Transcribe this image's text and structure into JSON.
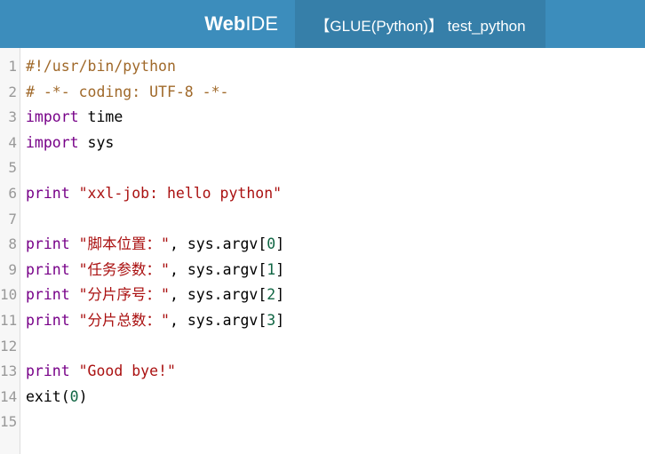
{
  "header": {
    "brand_bold": "Web",
    "brand_thin": "IDE",
    "tab_label": "【GLUE(Python)】 test_python"
  },
  "colors": {
    "header_bg": "#3c8dbc",
    "tab_bg": "#367fa9",
    "comment": "#a0692a",
    "keyword": "#770088",
    "string": "#aa1111",
    "number": "#116644"
  },
  "editor": {
    "lines": [
      {
        "n": "1",
        "tokens": [
          {
            "t": "comment",
            "v": "#!/usr/bin/python"
          }
        ]
      },
      {
        "n": "2",
        "tokens": [
          {
            "t": "comment",
            "v": "# -*- coding: UTF-8 -*-"
          }
        ]
      },
      {
        "n": "3",
        "tokens": [
          {
            "t": "keyword",
            "v": "import"
          },
          {
            "t": "plain",
            "v": " time"
          }
        ]
      },
      {
        "n": "4",
        "tokens": [
          {
            "t": "keyword",
            "v": "import"
          },
          {
            "t": "plain",
            "v": " sys"
          }
        ]
      },
      {
        "n": "5",
        "tokens": []
      },
      {
        "n": "6",
        "tokens": [
          {
            "t": "keyword",
            "v": "print"
          },
          {
            "t": "plain",
            "v": " "
          },
          {
            "t": "string",
            "v": "\"xxl-job: hello python\""
          }
        ]
      },
      {
        "n": "7",
        "tokens": []
      },
      {
        "n": "8",
        "tokens": [
          {
            "t": "keyword",
            "v": "print"
          },
          {
            "t": "plain",
            "v": " "
          },
          {
            "t": "string",
            "v": "\"脚本位置：\""
          },
          {
            "t": "plain",
            "v": ", sys.argv["
          },
          {
            "t": "number",
            "v": "0"
          },
          {
            "t": "plain",
            "v": "]"
          }
        ]
      },
      {
        "n": "9",
        "tokens": [
          {
            "t": "keyword",
            "v": "print"
          },
          {
            "t": "plain",
            "v": " "
          },
          {
            "t": "string",
            "v": "\"任务参数：\""
          },
          {
            "t": "plain",
            "v": ", sys.argv["
          },
          {
            "t": "number",
            "v": "1"
          },
          {
            "t": "plain",
            "v": "]"
          }
        ]
      },
      {
        "n": "10",
        "tokens": [
          {
            "t": "keyword",
            "v": "print"
          },
          {
            "t": "plain",
            "v": " "
          },
          {
            "t": "string",
            "v": "\"分片序号：\""
          },
          {
            "t": "plain",
            "v": ", sys.argv["
          },
          {
            "t": "number",
            "v": "2"
          },
          {
            "t": "plain",
            "v": "]"
          }
        ]
      },
      {
        "n": "11",
        "tokens": [
          {
            "t": "keyword",
            "v": "print"
          },
          {
            "t": "plain",
            "v": " "
          },
          {
            "t": "string",
            "v": "\"分片总数：\""
          },
          {
            "t": "plain",
            "v": ", sys.argv["
          },
          {
            "t": "number",
            "v": "3"
          },
          {
            "t": "plain",
            "v": "]"
          }
        ]
      },
      {
        "n": "12",
        "tokens": []
      },
      {
        "n": "13",
        "tokens": [
          {
            "t": "keyword",
            "v": "print"
          },
          {
            "t": "plain",
            "v": " "
          },
          {
            "t": "string",
            "v": "\"Good bye!\""
          }
        ]
      },
      {
        "n": "14",
        "tokens": [
          {
            "t": "plain",
            "v": "exit("
          },
          {
            "t": "number",
            "v": "0"
          },
          {
            "t": "plain",
            "v": ")"
          }
        ]
      },
      {
        "n": "15",
        "tokens": []
      }
    ]
  }
}
